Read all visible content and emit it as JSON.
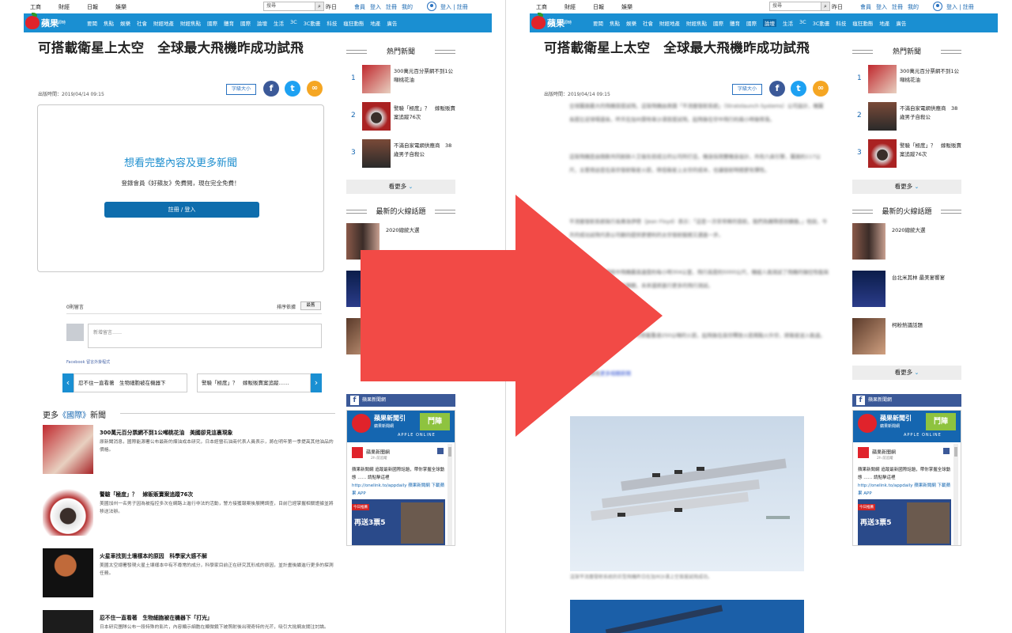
{
  "topbar": {
    "links": [
      "工商",
      "財經",
      "日報",
      "娛樂"
    ],
    "search_placeholder": "搜尋",
    "date": "昨日",
    "user_links": [
      "會員",
      "登入",
      "註冊",
      "我的"
    ],
    "login": "登入 | 註冊"
  },
  "nav": {
    "logo": "蘋果",
    "logo_sub": "即時",
    "items": [
      "要聞",
      "焦點",
      "娛樂",
      "社會",
      "財經地產",
      "財經焦點",
      "國際",
      "體育",
      "國際",
      "論壇",
      "生活",
      "3C",
      "3C動畫",
      "科技",
      "瘋狂動態",
      "地產",
      "廣告"
    ],
    "active_index": 9
  },
  "article": {
    "title": "可搭載衛星上太空　全球最大飛機昨成功試飛",
    "pubtime": "出版時間：2019/04/14 09:15",
    "font_button": "字級大小",
    "body_paragraphs": [
      "全球翼展最大的飛機首度試飛，這架飛機由美國「平流層發射系統」（Stratolaunch Systems）公司設計，機翼長度比足球場還長，昨天在加州莫哈韋沙漠首度試飛，起飛後在空中飛行約兩小時後降落。",
      "這架飛機是由微軟共同創辦人艾倫生前成立的公司所打造，機身採用雙機身設計，共有六具引擎，翼展約117公尺，主要用途是在高空發射衛星火箭，降低衛星上太空的成本，也讓發射時間更有彈性。",
      "平流層發射系統執行長弗洛伊德（Jean Floyd）表示：「這是一次非常棒的首航，我們為團隊感到驕傲。」他說，今天的成功試飛代表公司朝向提供更便利的太空發射服務又邁進一步。",
      "公司指出，試飛過程中飛機最高速度約每小時304公里，飛行高度約5000公尺，機組人員測試了飛機的操控性能與各項系統，整體表現符合預期，未來還將進行更多的飛行測試。",
      "這架巨型飛機重約226公噸，可搭載重達250公噸的火箭，起飛後在高空釋放火箭再點火升空，將衛星送入軌道。",
      "相關新聞請見"
    ],
    "body_link": "更多相關新聞",
    "caption": "這架平流層發射系統的巨型飛機昨日在加州沙漠上空首度試飛成功。"
  },
  "paywall": {
    "heading": "想看完整內容及更多新聞",
    "text": "登錄會員《好蘋友》免費閱，現在完全免費！",
    "button": "註冊 / 登入"
  },
  "comments": {
    "count": "0則留言",
    "sort_label": "排序依據",
    "sort_value": "最舊",
    "placeholder": "新增留言……",
    "plugin": "Facebook 留言外掛程式"
  },
  "prevnext": {
    "prev": "忍不住一直看著　生物細胞被在機器下",
    "next": "警驗「極度」？　嫁販販賣案追蹤……"
  },
  "more_news": {
    "prefix": "更多",
    "category": "《國際》",
    "suffix": "新聞",
    "items": [
      {
        "title": "300萬元百分票網不到1公噸桃花油　美國卻見這裏現象",
        "desc": "原新聞消息，國際能源署公布最新的煉油成本研究，日本經營石油商代表人員表示，將在明年第一季提高其他油品的價格。"
      },
      {
        "title": "警驗「極度」？　嫁販販賣案追蹤76次",
        "desc": "美國加州一名男子因為被指控多次在網路上進行非法的活動，警方接獲報案後展開調查，目前已經掌握相關證據並將移送法辦。"
      },
      {
        "title": "火星車找到土壤樣本的原因　科學家大感不解",
        "desc": "美國太空總署發現火星土壤樣本中有不尋常的成分，科學家目前正在研究其形成的原因，並計畫後續進行更多的探測任務。"
      },
      {
        "title": "忍不住一直看著　生物細胞被在機器下「打光」",
        "desc": "日本研究團隊公布一段特殊的影片，內容顯示細胞在顯微鏡下被照射後出現奇特的光芒，吸引大批網友關注討論。"
      }
    ]
  },
  "sidebar": {
    "hot_title": "熱門新聞",
    "hot_items_left": [
      {
        "num": "1",
        "title": "300萬元百分票網不到1公噸桃花油"
      },
      {
        "num": "2",
        "title": "警驗「極度」？　嫁販販賣案追蹤76次"
      },
      {
        "num": "3",
        "title": "不滿自家電網供應商　38歲男子自殺公"
      }
    ],
    "hot_items_right": [
      {
        "num": "1",
        "title": "300萬元百分票網不到1公噸桃花油"
      },
      {
        "num": "2",
        "title": "不滿自家電網供應商　38歲男子自殺公"
      },
      {
        "num": "3",
        "title": "警驗「極度」？　嫁販販賣案追蹤76次"
      }
    ],
    "more": "看更多",
    "topics_title": "最新的火線話題",
    "topics": [
      "2020總統大選",
      "台北米其林 最美宴饗宴",
      "柯粉熱議話題"
    ],
    "fb_title": "蘋果新聞網",
    "fb_banner_title": "蘋果新聞引",
    "fb_banner_sub": "蘋果新聞網",
    "fb_banner_en": "APPLE ONLINE",
    "fb_banner_tag": "鬥陣",
    "fb_page": "蘋果新聞網",
    "fb_likes": "2h 前追蹤",
    "fb_post": "蘋果新聞網 追蹤最新國際話題，帶你掌握全球動態 …… 請點擊這裡",
    "fb_post_link": "http://onelink.to/appdaily 蘋果新聞網 下載蘋果 APP",
    "fb_img_tag": "今日推薦",
    "fb_img_text": "再送3票5"
  }
}
